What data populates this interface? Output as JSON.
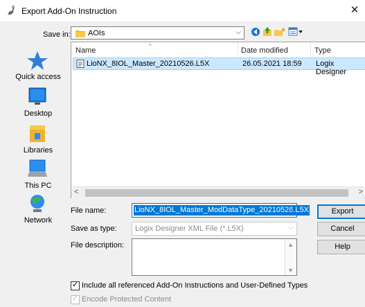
{
  "window": {
    "title": "Export Add-On Instruction",
    "close_glyph": "✕"
  },
  "save_in": {
    "label": "Save in:",
    "value": "AOIs"
  },
  "places": [
    "Quick access",
    "Desktop",
    "Libraries",
    "This PC",
    "Network"
  ],
  "columns": {
    "name": "Name",
    "date": "Date modified",
    "type": "Type"
  },
  "files": [
    {
      "name": "LioNX_8IOL_Master_20210526.L5X",
      "date": "26.05.2021 18:59",
      "type": "Logix Designer"
    }
  ],
  "form": {
    "file_name_label": "File name:",
    "file_name_value": "LioNX_8IOL_Master_ModDataType_20210526.L5X",
    "save_as_type_label": "Save as type:",
    "save_as_type_value": "Logix Designer XML File (*.L5X)",
    "file_description_label": "File description:"
  },
  "buttons": {
    "export": "Export",
    "cancel": "Cancel",
    "help": "Help"
  },
  "options": {
    "include_referenced": {
      "label": "Include all referenced Add-On Instructions and User-Defined Types",
      "checked": true
    },
    "encode_protected": {
      "label": "Encode Protected Content",
      "checked": true,
      "disabled": true
    }
  },
  "colors": {
    "selection": "#0078d7",
    "row_highlight": "#cce8ff",
    "dialog_bg": "#f0f0f0"
  }
}
